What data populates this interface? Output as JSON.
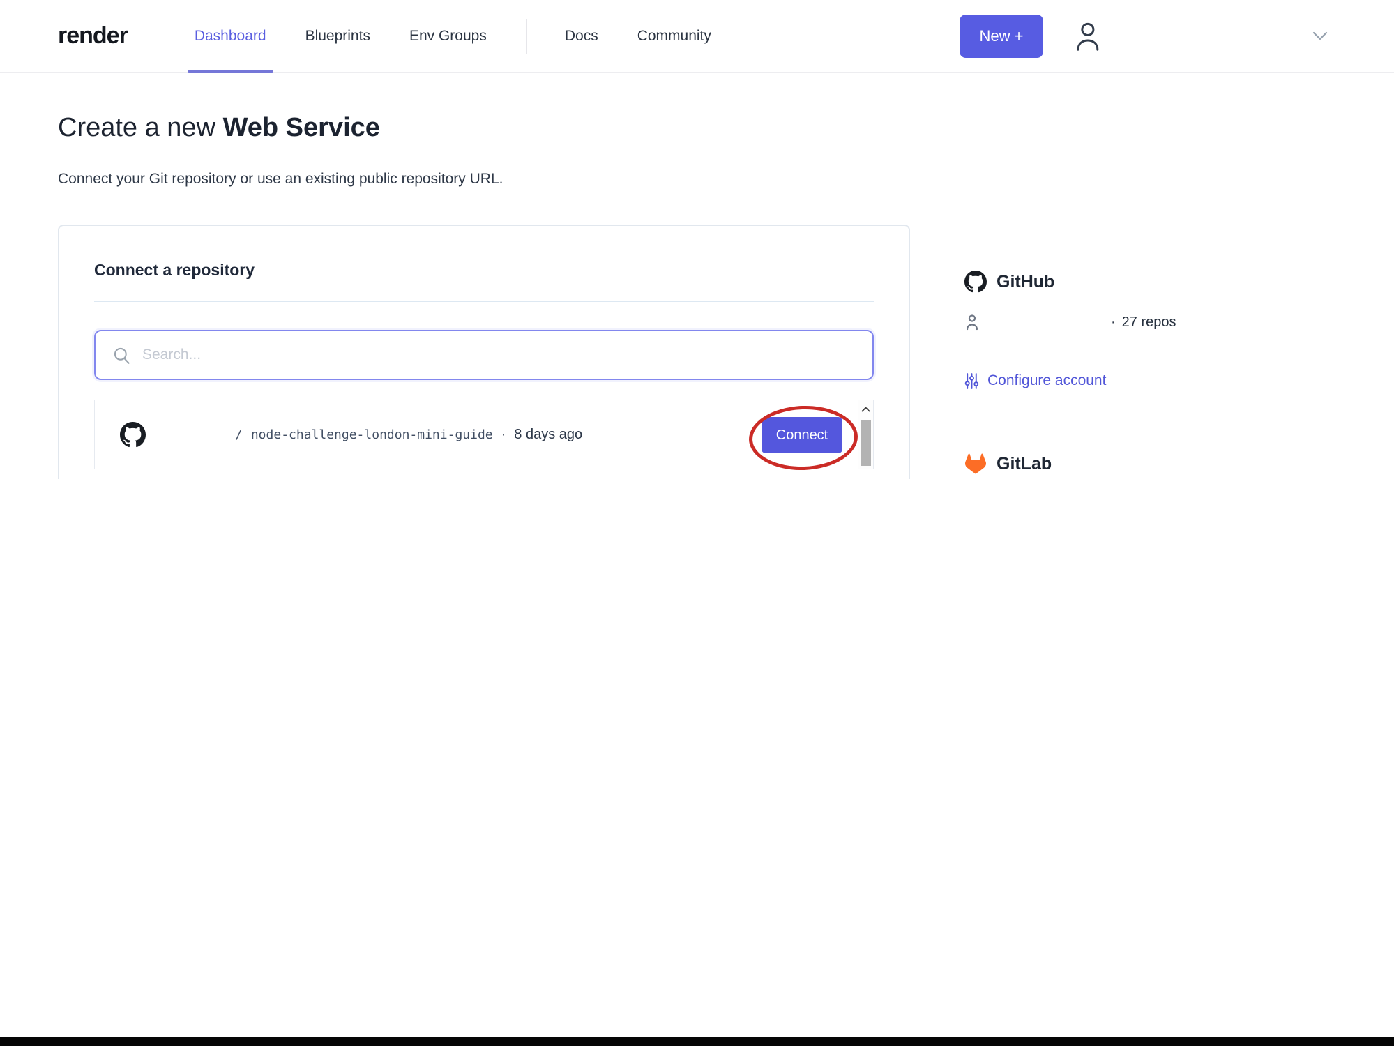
{
  "nav": {
    "logo": "render",
    "items": [
      {
        "label": "Dashboard",
        "active": true
      },
      {
        "label": "Blueprints",
        "active": false
      },
      {
        "label": "Env Groups",
        "active": false
      },
      {
        "label": "Docs",
        "active": false
      },
      {
        "label": "Community",
        "active": false
      }
    ],
    "new_button_label": "New +"
  },
  "page": {
    "title_prefix": "Create a new ",
    "title_emphasis": "Web Service",
    "subtitle": "Connect your Git repository or use an existing public repository URL."
  },
  "repo_card": {
    "heading": "Connect a repository",
    "search_placeholder": "Search...",
    "repo_row": {
      "path_slash": "/",
      "repo_name": "node-challenge-london-mini-guide",
      "separator": "·",
      "updated": "8 days ago",
      "connect_label": "Connect"
    }
  },
  "sidebar": {
    "github": {
      "title": "GitHub",
      "separator": "·",
      "repo_count": "27 repos",
      "configure_label": "Configure account"
    },
    "gitlab": {
      "title": "GitLab"
    }
  },
  "colors": {
    "accent": "#575ce2",
    "annotation_red": "#cb2b26",
    "gitlab_orange": "#fc6d26",
    "github_black": "#191d23"
  }
}
